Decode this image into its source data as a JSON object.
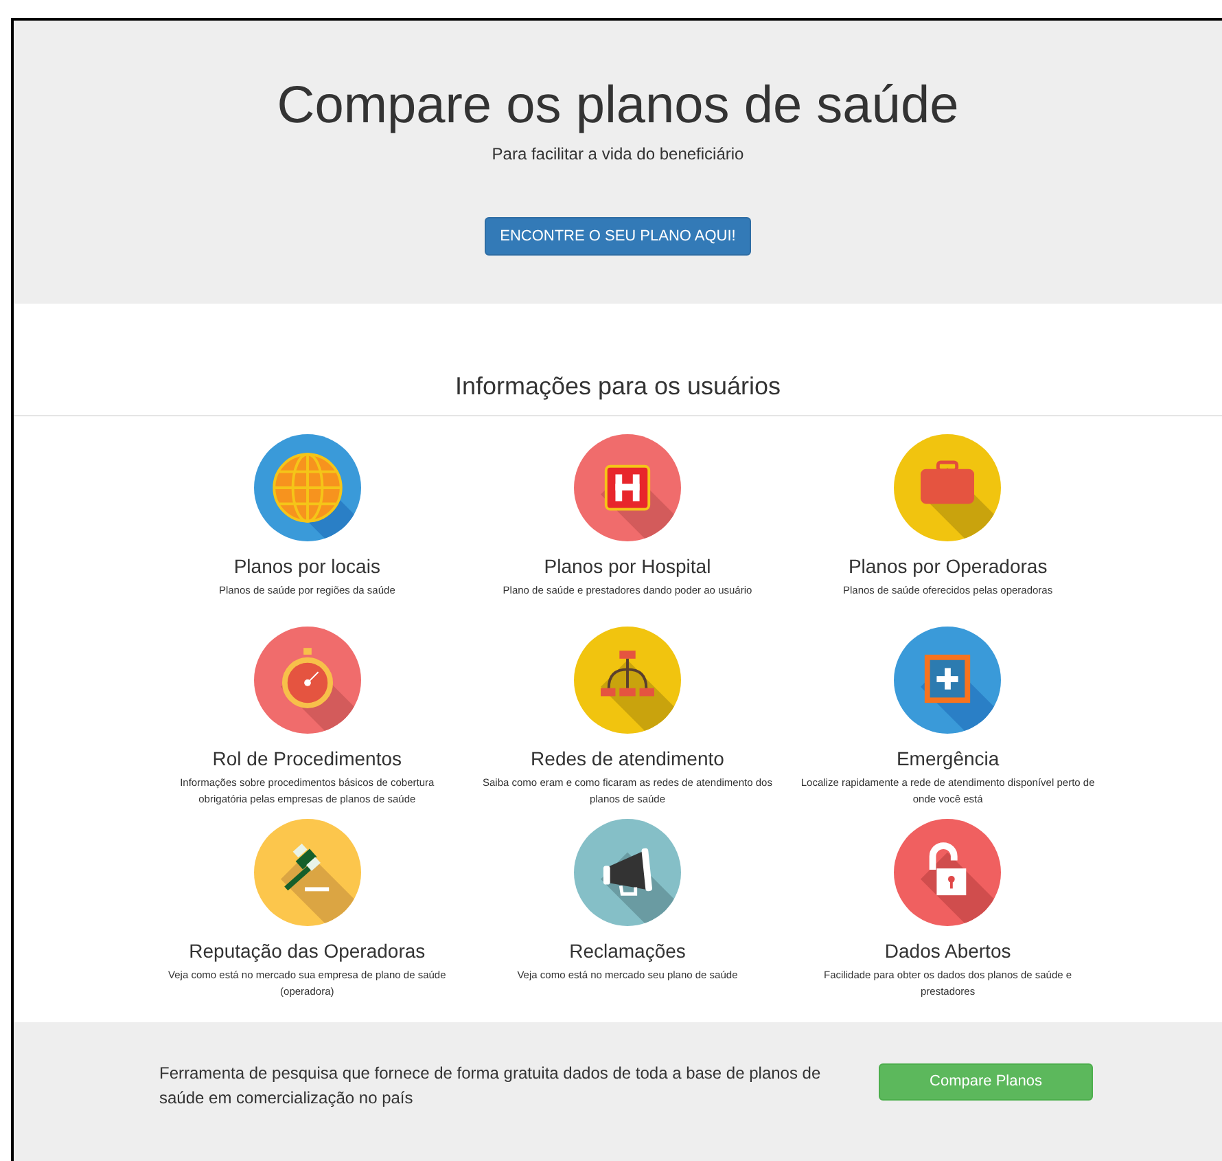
{
  "hero": {
    "title": "Compare os planos de saúde",
    "subtitle": "Para facilitar a vida do beneficiário",
    "button": "ENCONTRE O SEU PLANO AQUI!"
  },
  "section": {
    "heading": "Informações para os usuários"
  },
  "items": [
    {
      "kind": "globe",
      "title": "Planos por locais",
      "description": "Planos de saúde por regiões da saúde"
    },
    {
      "kind": "hospital",
      "title": "Planos por Hospital",
      "description": "Plano de saúde e prestadores dando poder ao usuário"
    },
    {
      "kind": "briefcase",
      "title": "Planos por Operadoras",
      "description": "Planos de saúde oferecidos pelas operadoras"
    },
    {
      "kind": "stopwatch",
      "title": "Rol de Procedimentos",
      "description": "Informações sobre procedimentos básicos de cobertura obrigatória pelas empresas de planos de saúde"
    },
    {
      "kind": "network",
      "title": "Redes de atendimento",
      "description": "Saiba como eram e como ficaram as redes de atendimento dos planos de saúde"
    },
    {
      "kind": "emergency",
      "title": "Emergência",
      "description": "Localize rapidamente a rede de atendimento disponível perto de onde você está"
    },
    {
      "kind": "gavel",
      "title": "Reputação das Operadoras",
      "description": "Veja como está no mercado sua empresa de plano de saúde (operadora)"
    },
    {
      "kind": "megaphone",
      "title": "Reclamações",
      "description": "Veja como está no mercado seu plano de saúde"
    },
    {
      "kind": "lock",
      "title": "Dados Abertos",
      "description": "Facilidade para obter os dados dos planos de saúde e prestadores"
    }
  ],
  "footer": {
    "text": "Ferramenta de pesquisa que fornece de forma gratuita dados de toda a base de planos de saúde em comercialização no país",
    "button": "Compare Planos"
  }
}
